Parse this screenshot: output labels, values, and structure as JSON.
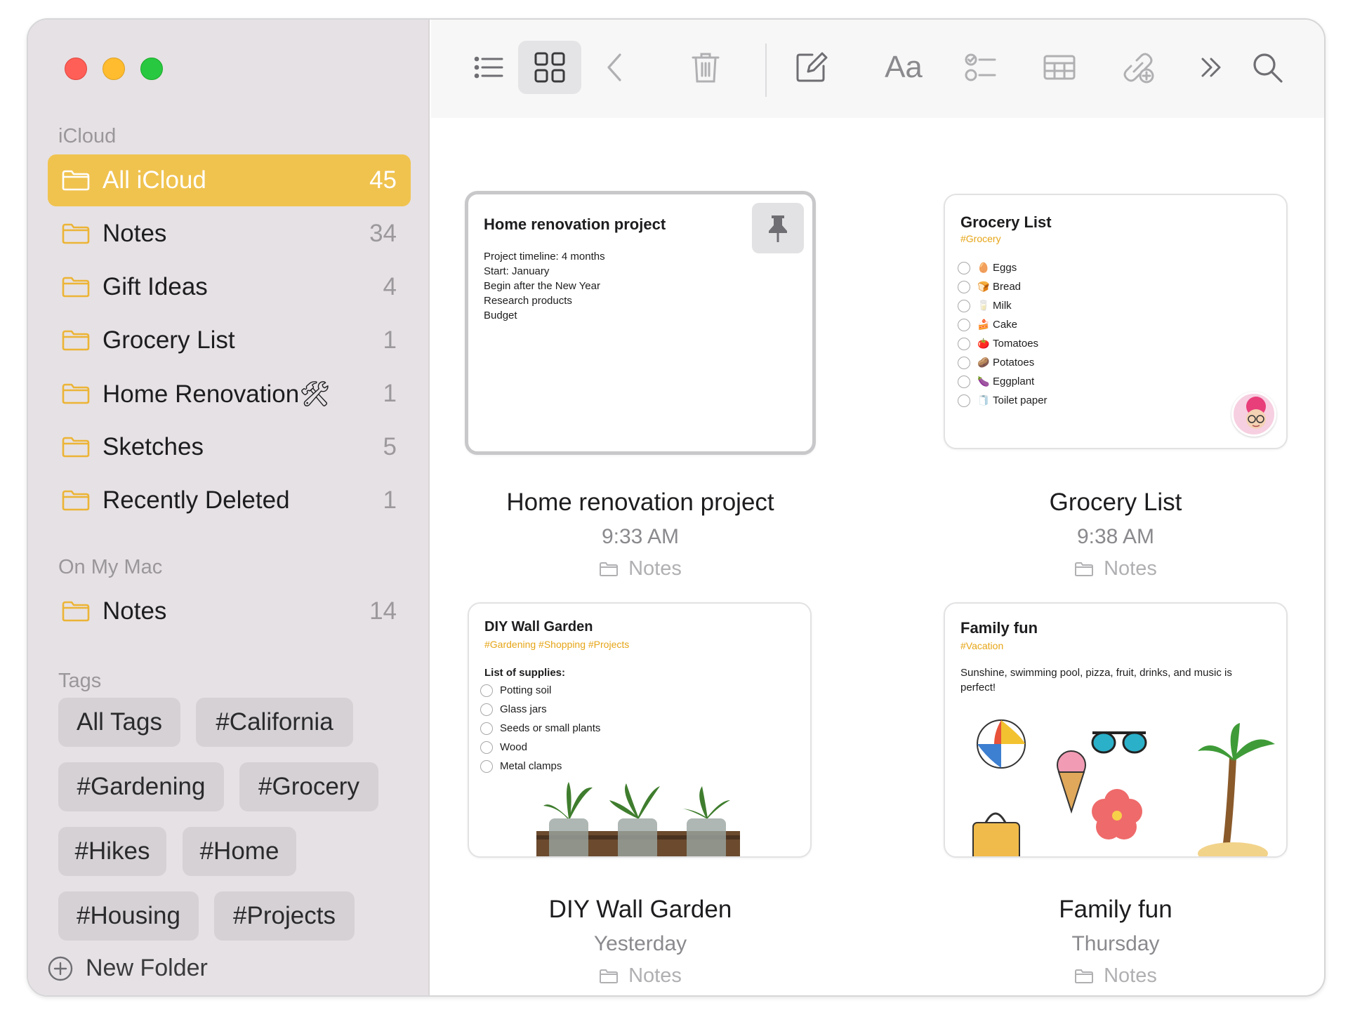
{
  "sidebar": {
    "icloud_label": "iCloud",
    "icloud_folders": [
      {
        "name": "All iCloud",
        "count": "45",
        "selected": true
      },
      {
        "name": "Notes",
        "count": "34"
      },
      {
        "name": "Gift Ideas",
        "count": "4"
      },
      {
        "name": "Grocery List",
        "count": "1"
      },
      {
        "name": "Home Renovation🛠",
        "count": "1"
      },
      {
        "name": "Sketches",
        "count": "5"
      },
      {
        "name": "Recently Deleted",
        "count": "1"
      }
    ],
    "mac_label": "On My Mac",
    "mac_folders": [
      {
        "name": "Notes",
        "count": "14"
      }
    ],
    "tags_label": "Tags",
    "tags": [
      "All Tags",
      "#California",
      "#Gardening",
      "#Grocery",
      "#Hikes",
      "#Home",
      "#Housing",
      "#Projects"
    ],
    "new_folder": "New Folder"
  },
  "toolbar": {
    "format_label": "Aa",
    "icons": [
      "list-view-icon",
      "gallery-view-icon",
      "back-icon",
      "trash-icon",
      "compose-icon",
      "format-icon",
      "checklist-icon",
      "table-icon",
      "collaborate-icon",
      "more-icon",
      "search-icon"
    ]
  },
  "notes": [
    {
      "title": "Home renovation project",
      "lines": [
        "Project timeline: 4 months",
        "Start: January",
        "Begin after the New Year",
        "Research products",
        "Budget"
      ],
      "caption_title": "Home renovation project",
      "time": "9:33 AM",
      "folder": "Notes"
    },
    {
      "title": "Grocery List",
      "tags": "#Grocery",
      "items": [
        {
          "emoji": "🥚",
          "text": "Eggs"
        },
        {
          "emoji": "🍞",
          "text": "Bread"
        },
        {
          "emoji": "🥛",
          "text": "Milk"
        },
        {
          "emoji": "🍰",
          "text": "Cake"
        },
        {
          "emoji": "🍅",
          "text": "Tomatoes"
        },
        {
          "emoji": "🥔",
          "text": "Potatoes"
        },
        {
          "emoji": "🍆",
          "text": "Eggplant"
        },
        {
          "emoji": "🧻",
          "text": "Toilet paper"
        }
      ],
      "caption_title": "Grocery List",
      "time": "9:38 AM",
      "folder": "Notes"
    },
    {
      "title": "DIY Wall Garden",
      "tags": "#Gardening #Shopping #Projects",
      "subheading": "List of supplies:",
      "items": [
        "Potting soil",
        "Glass jars",
        "Seeds or small plants",
        "Wood",
        "Metal clamps"
      ],
      "caption_title": "DIY Wall Garden",
      "time": "Yesterday",
      "folder": "Notes"
    },
    {
      "title": "Family fun",
      "tags": "#Vacation",
      "body": "Sunshine, swimming pool, pizza, fruit, drinks, and music is perfect!",
      "caption_title": "Family fun",
      "time": "Thursday",
      "folder": "Notes"
    }
  ]
}
